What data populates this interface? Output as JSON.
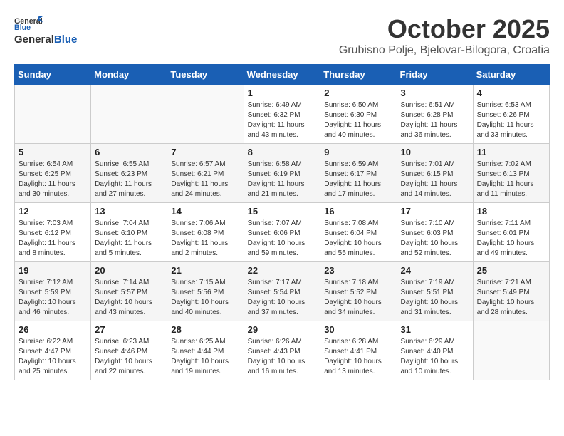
{
  "header": {
    "logo_general": "General",
    "logo_blue": "Blue",
    "month_title": "October 2025",
    "location": "Grubisno Polje, Bjelovar-Bilogora, Croatia"
  },
  "weekdays": [
    "Sunday",
    "Monday",
    "Tuesday",
    "Wednesday",
    "Thursday",
    "Friday",
    "Saturday"
  ],
  "weeks": [
    [
      {
        "day": "",
        "info": ""
      },
      {
        "day": "",
        "info": ""
      },
      {
        "day": "",
        "info": ""
      },
      {
        "day": "1",
        "info": "Sunrise: 6:49 AM\nSunset: 6:32 PM\nDaylight: 11 hours and 43 minutes."
      },
      {
        "day": "2",
        "info": "Sunrise: 6:50 AM\nSunset: 6:30 PM\nDaylight: 11 hours and 40 minutes."
      },
      {
        "day": "3",
        "info": "Sunrise: 6:51 AM\nSunset: 6:28 PM\nDaylight: 11 hours and 36 minutes."
      },
      {
        "day": "4",
        "info": "Sunrise: 6:53 AM\nSunset: 6:26 PM\nDaylight: 11 hours and 33 minutes."
      }
    ],
    [
      {
        "day": "5",
        "info": "Sunrise: 6:54 AM\nSunset: 6:25 PM\nDaylight: 11 hours and 30 minutes."
      },
      {
        "day": "6",
        "info": "Sunrise: 6:55 AM\nSunset: 6:23 PM\nDaylight: 11 hours and 27 minutes."
      },
      {
        "day": "7",
        "info": "Sunrise: 6:57 AM\nSunset: 6:21 PM\nDaylight: 11 hours and 24 minutes."
      },
      {
        "day": "8",
        "info": "Sunrise: 6:58 AM\nSunset: 6:19 PM\nDaylight: 11 hours and 21 minutes."
      },
      {
        "day": "9",
        "info": "Sunrise: 6:59 AM\nSunset: 6:17 PM\nDaylight: 11 hours and 17 minutes."
      },
      {
        "day": "10",
        "info": "Sunrise: 7:01 AM\nSunset: 6:15 PM\nDaylight: 11 hours and 14 minutes."
      },
      {
        "day": "11",
        "info": "Sunrise: 7:02 AM\nSunset: 6:13 PM\nDaylight: 11 hours and 11 minutes."
      }
    ],
    [
      {
        "day": "12",
        "info": "Sunrise: 7:03 AM\nSunset: 6:12 PM\nDaylight: 11 hours and 8 minutes."
      },
      {
        "day": "13",
        "info": "Sunrise: 7:04 AM\nSunset: 6:10 PM\nDaylight: 11 hours and 5 minutes."
      },
      {
        "day": "14",
        "info": "Sunrise: 7:06 AM\nSunset: 6:08 PM\nDaylight: 11 hours and 2 minutes."
      },
      {
        "day": "15",
        "info": "Sunrise: 7:07 AM\nSunset: 6:06 PM\nDaylight: 10 hours and 59 minutes."
      },
      {
        "day": "16",
        "info": "Sunrise: 7:08 AM\nSunset: 6:04 PM\nDaylight: 10 hours and 55 minutes."
      },
      {
        "day": "17",
        "info": "Sunrise: 7:10 AM\nSunset: 6:03 PM\nDaylight: 10 hours and 52 minutes."
      },
      {
        "day": "18",
        "info": "Sunrise: 7:11 AM\nSunset: 6:01 PM\nDaylight: 10 hours and 49 minutes."
      }
    ],
    [
      {
        "day": "19",
        "info": "Sunrise: 7:12 AM\nSunset: 5:59 PM\nDaylight: 10 hours and 46 minutes."
      },
      {
        "day": "20",
        "info": "Sunrise: 7:14 AM\nSunset: 5:57 PM\nDaylight: 10 hours and 43 minutes."
      },
      {
        "day": "21",
        "info": "Sunrise: 7:15 AM\nSunset: 5:56 PM\nDaylight: 10 hours and 40 minutes."
      },
      {
        "day": "22",
        "info": "Sunrise: 7:17 AM\nSunset: 5:54 PM\nDaylight: 10 hours and 37 minutes."
      },
      {
        "day": "23",
        "info": "Sunrise: 7:18 AM\nSunset: 5:52 PM\nDaylight: 10 hours and 34 minutes."
      },
      {
        "day": "24",
        "info": "Sunrise: 7:19 AM\nSunset: 5:51 PM\nDaylight: 10 hours and 31 minutes."
      },
      {
        "day": "25",
        "info": "Sunrise: 7:21 AM\nSunset: 5:49 PM\nDaylight: 10 hours and 28 minutes."
      }
    ],
    [
      {
        "day": "26",
        "info": "Sunrise: 6:22 AM\nSunset: 4:47 PM\nDaylight: 10 hours and 25 minutes."
      },
      {
        "day": "27",
        "info": "Sunrise: 6:23 AM\nSunset: 4:46 PM\nDaylight: 10 hours and 22 minutes."
      },
      {
        "day": "28",
        "info": "Sunrise: 6:25 AM\nSunset: 4:44 PM\nDaylight: 10 hours and 19 minutes."
      },
      {
        "day": "29",
        "info": "Sunrise: 6:26 AM\nSunset: 4:43 PM\nDaylight: 10 hours and 16 minutes."
      },
      {
        "day": "30",
        "info": "Sunrise: 6:28 AM\nSunset: 4:41 PM\nDaylight: 10 hours and 13 minutes."
      },
      {
        "day": "31",
        "info": "Sunrise: 6:29 AM\nSunset: 4:40 PM\nDaylight: 10 hours and 10 minutes."
      },
      {
        "day": "",
        "info": ""
      }
    ]
  ]
}
